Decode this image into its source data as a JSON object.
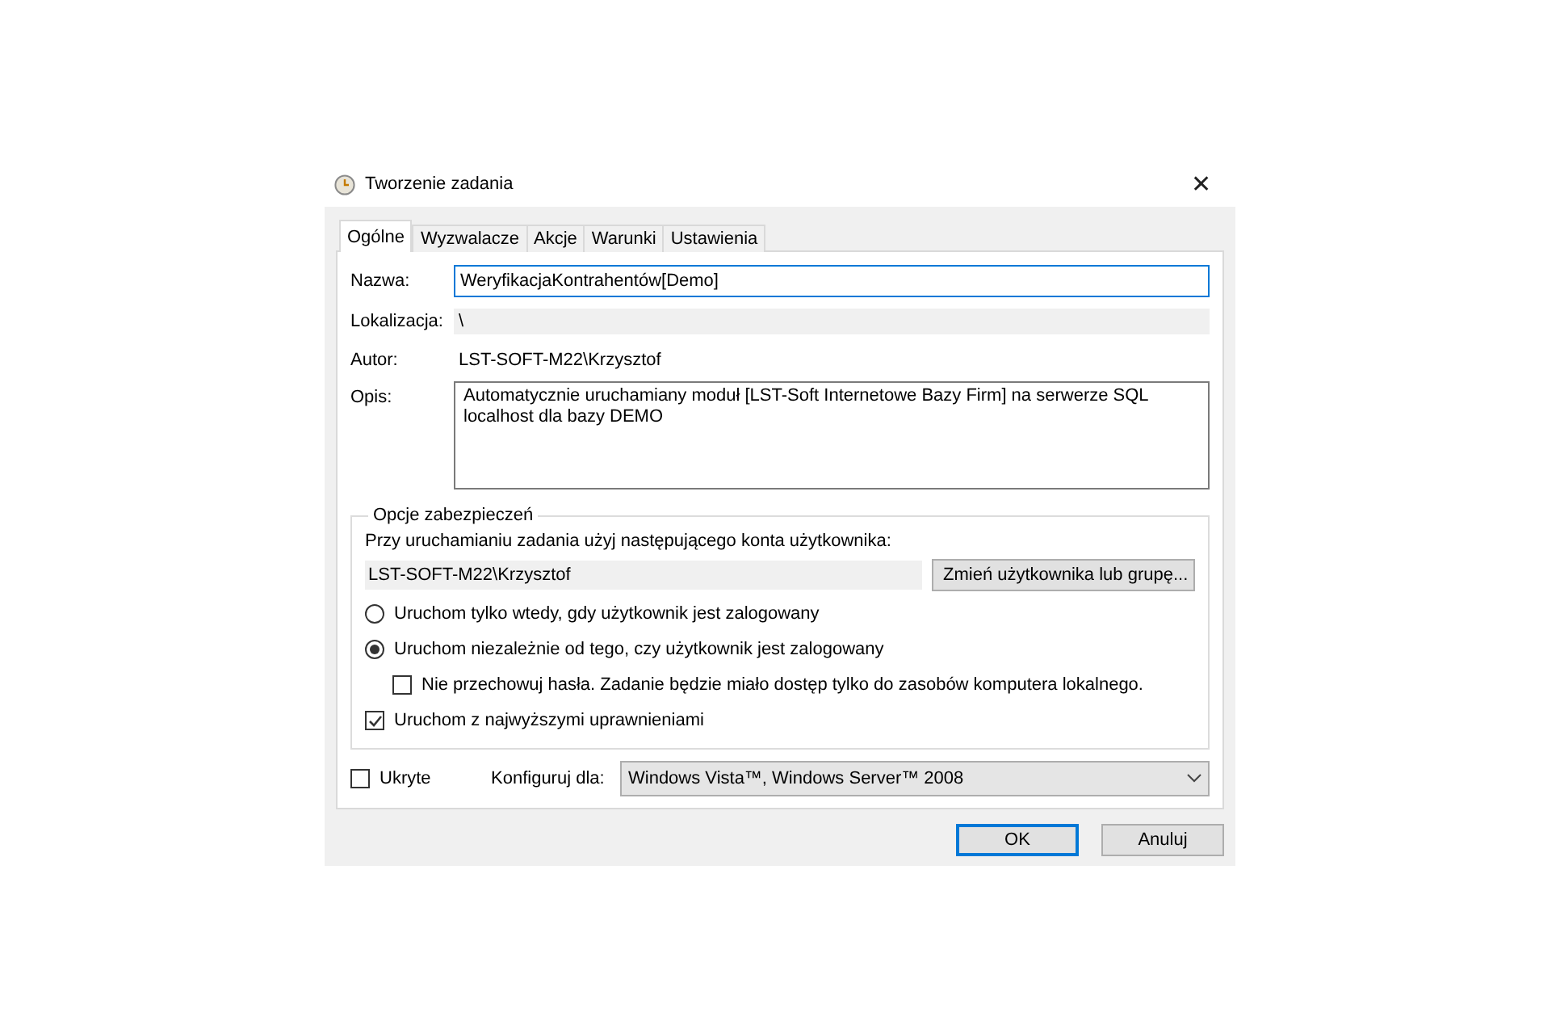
{
  "window": {
    "title": "Tworzenie zadania",
    "close": "✕"
  },
  "tabs": [
    {
      "label": "Ogólne",
      "selected": true
    },
    {
      "label": "Wyzwalacze",
      "selected": false
    },
    {
      "label": "Akcje",
      "selected": false
    },
    {
      "label": "Warunki",
      "selected": false
    },
    {
      "label": "Ustawienia",
      "selected": false
    }
  ],
  "general": {
    "name_label": "Nazwa:",
    "name_value": "WeryfikacjaKontrahentów[Demo]",
    "location_label": "Lokalizacja:",
    "location_value": "\\",
    "author_label": "Autor:",
    "author_value": "LST-SOFT-M22\\Krzysztof",
    "description_label": "Opis:",
    "description_value": "Automatycznie uruchamiany moduł [LST-Soft Internetowe Bazy Firm] na serwerze SQL localhost dla bazy DEMO"
  },
  "security": {
    "title": "Opcje zabezpieczeń",
    "account_prompt": "Przy uruchamianiu zadania użyj następującego konta użytkownika:",
    "account_value": "LST-SOFT-M22\\Krzysztof",
    "change_button": "Zmień użytkownika lub grupę...",
    "options": [
      {
        "kind": "radio",
        "label": "Uruchom tylko wtedy, gdy użytkownik jest zalogowany",
        "selected": false
      },
      {
        "kind": "radio",
        "label": "Uruchom niezależnie od tego, czy użytkownik jest zalogowany",
        "selected": true,
        "children": [
          {
            "kind": "checkbox",
            "label": "Nie przechowuj hasła. Zadanie będzie miało dostęp tylko do zasobów komputera lokalnego.",
            "checked": false
          }
        ]
      },
      {
        "kind": "checkbox",
        "label": "Uruchom z najwyższymi uprawnieniami",
        "checked": true
      }
    ]
  },
  "hidden": {
    "label": "Ukryte",
    "checked": false
  },
  "configure": {
    "label": "Konfiguruj dla:",
    "value": "Windows Vista™, Windows Server™ 2008"
  },
  "buttons": [
    {
      "label": "OK",
      "default": true
    },
    {
      "label": "Anuluj",
      "default": false
    }
  ]
}
